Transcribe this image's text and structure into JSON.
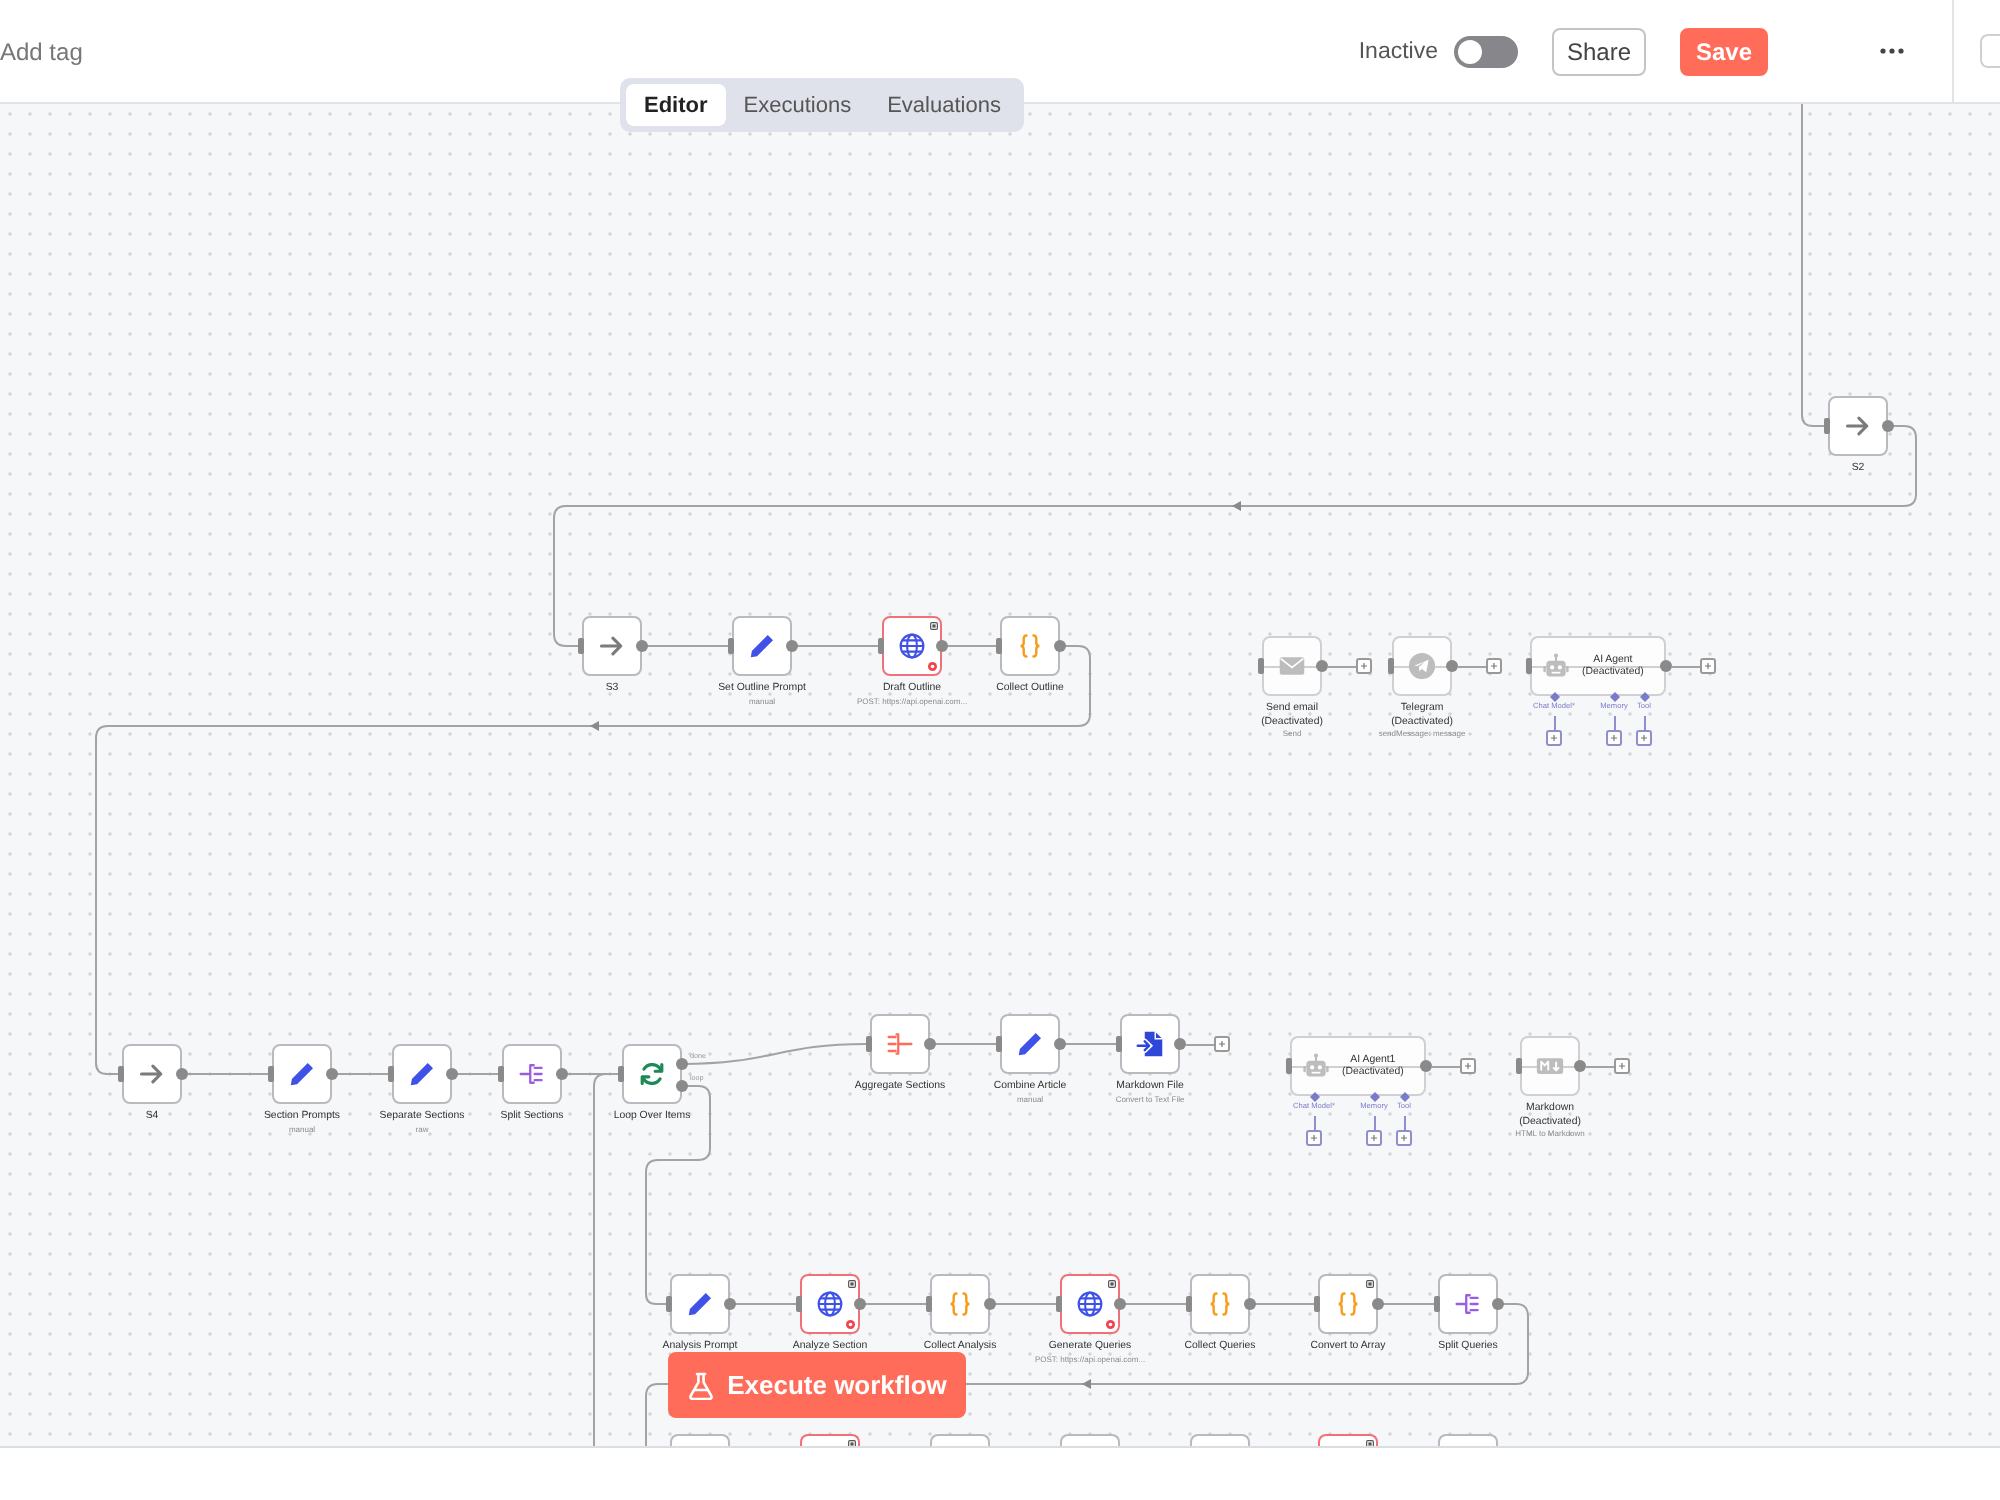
{
  "header": {
    "tag_link": "Add tag",
    "status_label": "Inactive",
    "active": false,
    "share_button": "Share",
    "save_button": "Save"
  },
  "tabs": [
    {
      "label": "Editor",
      "selected": true
    },
    {
      "label": "Executions",
      "selected": false
    },
    {
      "label": "Evaluations",
      "selected": false
    }
  ],
  "canvas": {
    "nodes": [
      {
        "kind": "noop",
        "label": "S2",
        "deactivated": false,
        "issue": false,
        "flag": false,
        "add_button": false
      },
      {
        "kind": "noop",
        "label": "S3",
        "deactivated": false,
        "issue": false,
        "flag": false,
        "add_button": false
      },
      {
        "kind": "set",
        "label": "Set Outline Prompt",
        "subtitle": "manual",
        "deactivated": false,
        "issue": false,
        "flag": false,
        "add_button": false
      },
      {
        "kind": "http",
        "label": "Draft Outline",
        "subtitle": "POST: https://api.openai.com...",
        "deactivated": false,
        "issue": true,
        "flag": true,
        "add_button": false
      },
      {
        "kind": "code",
        "label": "Collect Outline",
        "deactivated": false,
        "issue": false,
        "flag": false,
        "add_button": false
      },
      {
        "kind": "email",
        "label": "Send email",
        "status": "(Deactivated)",
        "subtitle": "Send",
        "deactivated": true,
        "issue": false,
        "flag": false,
        "add_button": true
      },
      {
        "kind": "telegram",
        "label": "Telegram",
        "status": "(Deactivated)",
        "subtitle": "sendMessage: message",
        "deactivated": true,
        "issue": false,
        "flag": false,
        "add_button": true
      },
      {
        "kind": "agent",
        "label": "AI Agent",
        "status": "(Deactivated)",
        "deactivated": true,
        "issue": false,
        "flag": false,
        "add_button": true,
        "ports": [
          {
            "label": "Chat Model*"
          },
          {
            "label": "Memory"
          },
          {
            "label": "Tool"
          }
        ]
      },
      {
        "kind": "noop",
        "label": "S4",
        "deactivated": false,
        "issue": false,
        "flag": false,
        "add_button": false
      },
      {
        "kind": "set",
        "label": "Section Prompts",
        "subtitle": "manual",
        "deactivated": false,
        "issue": false,
        "flag": false,
        "add_button": false
      },
      {
        "kind": "set",
        "label": "Separate Sections",
        "subtitle": "raw",
        "deactivated": false,
        "issue": false,
        "flag": false,
        "add_button": false
      },
      {
        "kind": "split",
        "label": "Split Sections",
        "deactivated": false,
        "issue": false,
        "flag": false,
        "add_button": false
      },
      {
        "kind": "loop",
        "label": "Loop Over Items",
        "outputs": [
          "done",
          "loop"
        ],
        "deactivated": false,
        "issue": false,
        "flag": false,
        "add_button": false
      },
      {
        "kind": "aggregate",
        "label": "Aggregate Sections",
        "deactivated": false,
        "issue": false,
        "flag": false,
        "add_button": false
      },
      {
        "kind": "set",
        "label": "Combine Article",
        "subtitle": "manual",
        "deactivated": false,
        "issue": false,
        "flag": false,
        "add_button": false
      },
      {
        "kind": "convert",
        "label": "Markdown File",
        "subtitle": "Convert to Text File",
        "deactivated": false,
        "issue": false,
        "flag": false,
        "add_button": true
      },
      {
        "kind": "agent",
        "label": "AI Agent1",
        "status": "(Deactivated)",
        "deactivated": true,
        "issue": false,
        "flag": false,
        "add_button": true,
        "ports": [
          {
            "label": "Chat Model*"
          },
          {
            "label": "Memory"
          },
          {
            "label": "Tool"
          }
        ]
      },
      {
        "kind": "markdown",
        "label": "Markdown",
        "status": "(Deactivated)",
        "subtitle": "HTML to Markdown",
        "deactivated": true,
        "issue": false,
        "flag": false,
        "add_button": true
      },
      {
        "kind": "set",
        "label": "Analysis Prompt",
        "deactivated": false,
        "issue": false,
        "flag": false,
        "add_button": false
      },
      {
        "kind": "http",
        "label": "Analyze Section",
        "deactivated": false,
        "issue": true,
        "flag": true,
        "add_button": false
      },
      {
        "kind": "code",
        "label": "Collect Analysis",
        "deactivated": false,
        "issue": false,
        "flag": false,
        "add_button": false
      },
      {
        "kind": "http",
        "label": "Generate Queries",
        "subtitle": "POST: https://api.openai.com...",
        "deactivated": false,
        "issue": true,
        "flag": true,
        "add_button": false
      },
      {
        "kind": "code",
        "label": "Collect Queries",
        "deactivated": false,
        "issue": false,
        "flag": false,
        "add_button": false
      },
      {
        "kind": "code",
        "label": "Convert to Array",
        "deactivated": false,
        "issue": false,
        "flag": true,
        "add_button": false
      },
      {
        "kind": "split",
        "label": "Split Queries",
        "deactivated": false,
        "issue": false,
        "flag": false,
        "add_button": false
      }
    ],
    "cut_off_nodes": [
      {
        "issue": false,
        "flag": false
      },
      {
        "issue": true,
        "flag": true
      },
      {
        "issue": false,
        "flag": false
      },
      {
        "issue": false,
        "flag": false
      },
      {
        "issue": false,
        "flag": false
      },
      {
        "issue": true,
        "flag": true
      },
      {
        "issue": false,
        "flag": false
      }
    ],
    "execute_button": "Execute workflow"
  }
}
